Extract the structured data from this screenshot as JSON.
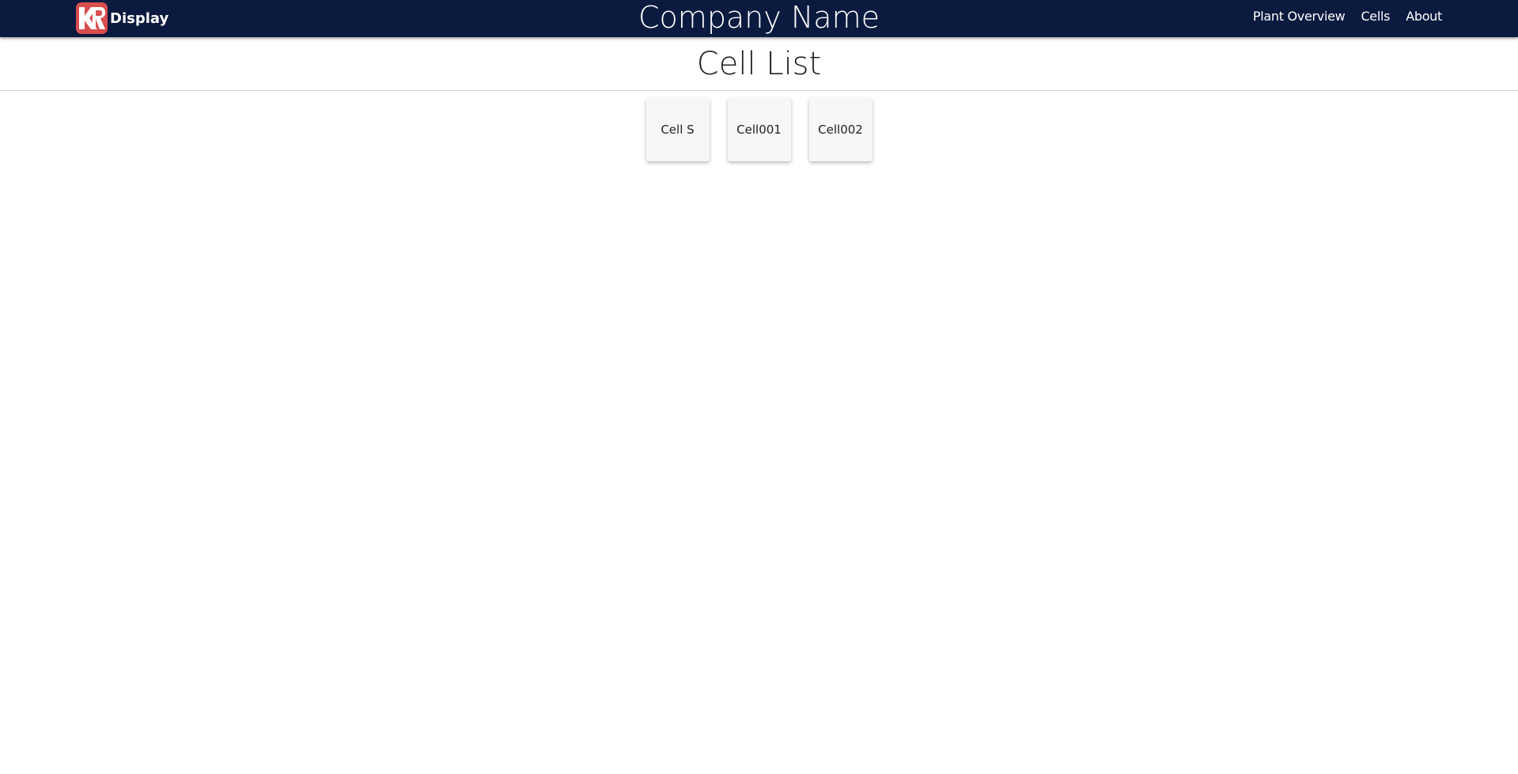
{
  "navbar": {
    "brand_label": "Display",
    "company_name": "Company Name",
    "links": [
      "Plant Overview",
      "Cells",
      "About"
    ],
    "background_color": "#0b1a3f",
    "logo_color": "#d94f4f"
  },
  "page": {
    "title": "Cell List"
  },
  "cells": [
    "Cell S",
    "Cell001",
    "Cell002"
  ]
}
